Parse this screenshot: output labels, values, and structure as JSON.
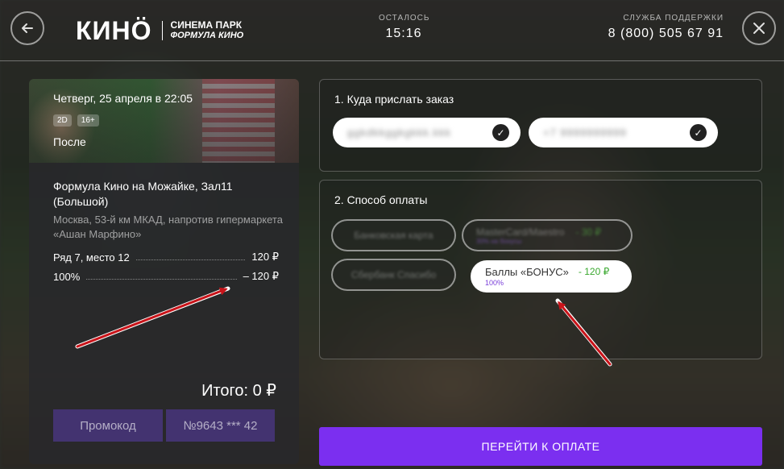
{
  "header": {
    "logo_main": "КИНÖ",
    "logo_line1": "СИНЕМА ПАРК",
    "logo_line2": "ФОРМУЛА КИНО",
    "timer_label": "ОСТАЛОСЬ",
    "timer_value": "15:16",
    "support_label": "СЛУЖБА ПОДДЕРЖКИ",
    "support_phone": "8 (800) 505 67 91",
    "back_icon": "arrow-left-icon",
    "close_icon": "close-icon"
  },
  "order": {
    "date": "Четверг, 25 апреля в 22:05",
    "badges": [
      "2D",
      "16+"
    ],
    "movie_title": "После",
    "cinema": "Формула Кино на Можайке, Зал11 (Большой)",
    "address": "Москва, 53-й км МКАД, напротив гипермаркета «Ашан Марфино»",
    "seat_label": "Ряд 7, место 12",
    "seat_price": "120 ₽",
    "discount_label": "100%",
    "discount_price": "– 120 ₽",
    "total": "Итого: 0 ₽",
    "promo_button": "Промокод",
    "card_button": "№9643 *** 42"
  },
  "delivery": {
    "title": "1. Куда прислать заказ",
    "email_value": "ggkdkkggkgkkk.kkk",
    "phone_value": "+7 9999999999",
    "check_icon": "check-icon"
  },
  "payment": {
    "title": "2. Способ оплаты",
    "options": [
      {
        "label": "Банковская карта"
      },
      {
        "label": "MasterCard/Maestro",
        "price": "- 30 ₽",
        "sub": "30% на бонусы"
      },
      {
        "label": "Сбербанк Спасибо"
      },
      {
        "label": "Баллы «БОНУС»",
        "price": "- 120 ₽",
        "sub": "100%"
      }
    ]
  },
  "pay_button": "ПЕРЕЙТИ К ОПЛАТЕ",
  "colors": {
    "accent": "#7b2ff0",
    "green_price": "#39a82e",
    "arrow_red": "#c8141a"
  }
}
